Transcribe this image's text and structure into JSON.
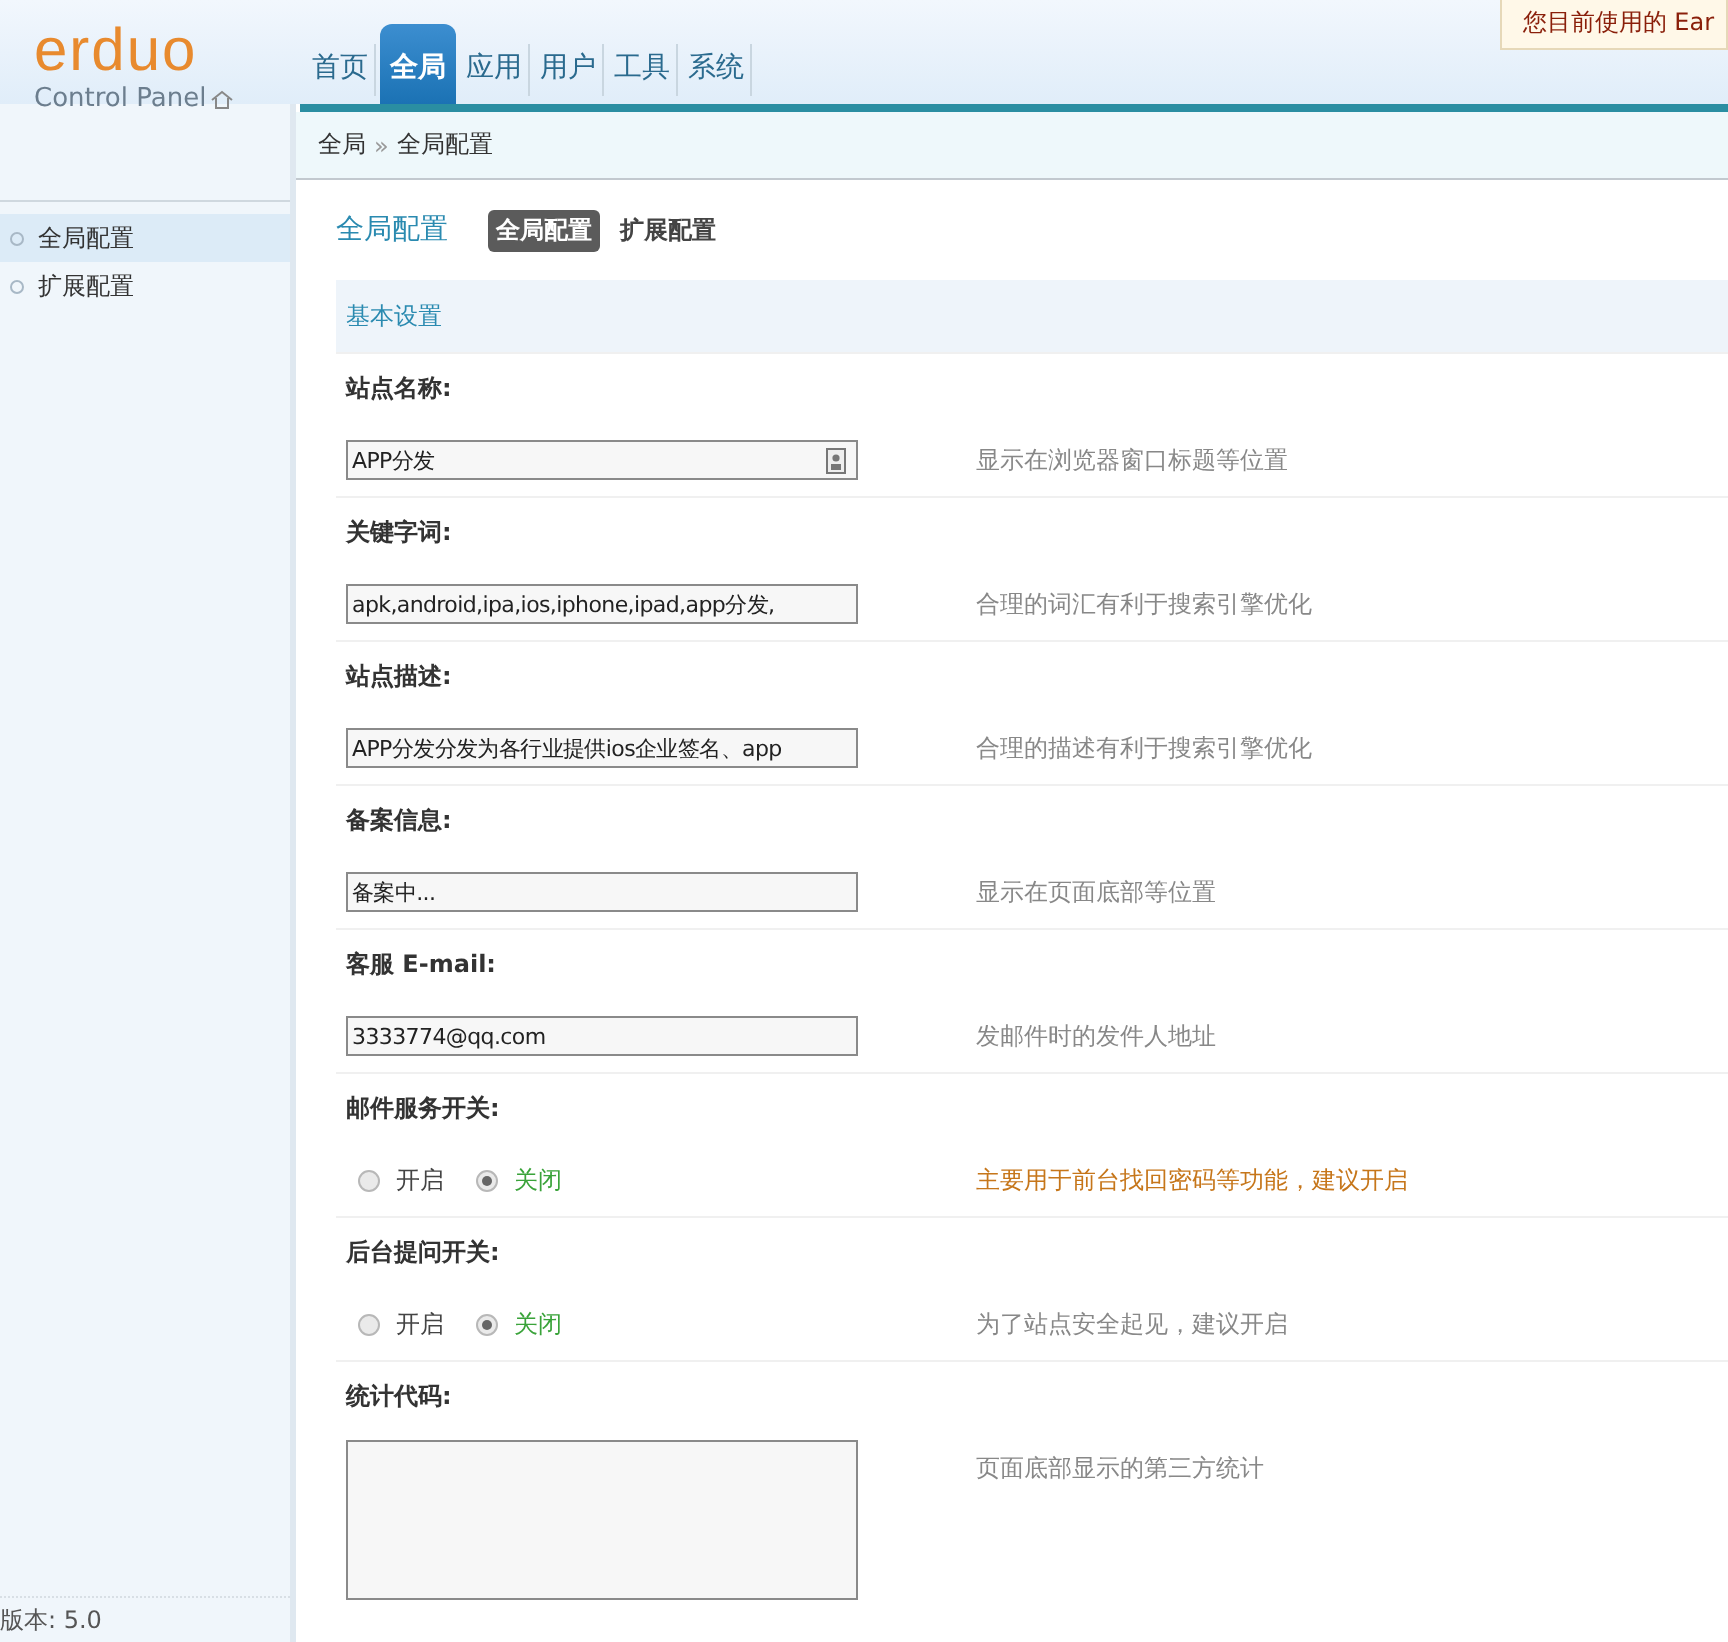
{
  "logo": {
    "name": "erduo",
    "subtitle": "Control Panel"
  },
  "nav": [
    {
      "label": "首页",
      "selected": false
    },
    {
      "label": "全局",
      "selected": true
    },
    {
      "label": "应用",
      "selected": false
    },
    {
      "label": "用户",
      "selected": false
    },
    {
      "label": "工具",
      "selected": false
    },
    {
      "label": "系统",
      "selected": false
    }
  ],
  "notice": "您目前使用的 Ear",
  "breadcrumb": [
    "全局",
    "»",
    "全局配置"
  ],
  "sidebar": {
    "items": [
      {
        "label": "全局配置",
        "selected": true
      },
      {
        "label": "扩展配置",
        "selected": false
      }
    ],
    "version": "版本: 5.0"
  },
  "page_title": "全局配置",
  "subtabs": [
    {
      "label": "全局配置",
      "selected": true
    },
    {
      "label": "扩展配置",
      "selected": false
    }
  ],
  "section": "基本设置",
  "settings": [
    {
      "label": "站点名称:",
      "kind": "text",
      "value": "APP分发",
      "has_icon": true,
      "hint": "显示在浏览器窗口标题等位置",
      "warning": false
    },
    {
      "label": "关键字词:",
      "kind": "text",
      "value": "apk,android,ipa,ios,iphone,ipad,app分发,",
      "has_icon": false,
      "hint": "合理的词汇有利于搜索引擎优化",
      "warning": false
    },
    {
      "label": "站点描述:",
      "kind": "text",
      "value": "APP分发分发为各行业提供ios企业签名、app",
      "has_icon": false,
      "hint": "合理的描述有利于搜索引擎优化",
      "warning": false
    },
    {
      "label": "备案信息:",
      "kind": "text",
      "value": "备案中...",
      "has_icon": false,
      "hint": "显示在页面底部等位置",
      "warning": false
    },
    {
      "label": "客服 E-mail:",
      "kind": "text",
      "value": "3333774@qq.com",
      "has_icon": false,
      "hint": "发邮件时的发件人地址",
      "warning": false
    },
    {
      "label": "邮件服务开关:",
      "kind": "radio",
      "options": [
        {
          "label": "开启",
          "selected": false
        },
        {
          "label": "关闭",
          "selected": true
        }
      ],
      "hint": "主要用于前台找回密码等功能，建议开启",
      "warning": true
    },
    {
      "label": "后台提问开关:",
      "kind": "radio",
      "options": [
        {
          "label": "开启",
          "selected": false
        },
        {
          "label": "关闭",
          "selected": true
        }
      ],
      "hint": "为了站点安全起见，建议开启",
      "warning": false
    },
    {
      "label": "统计代码:",
      "kind": "textarea",
      "hint": "页面底部显示的第三方统计",
      "warning": false
    }
  ]
}
